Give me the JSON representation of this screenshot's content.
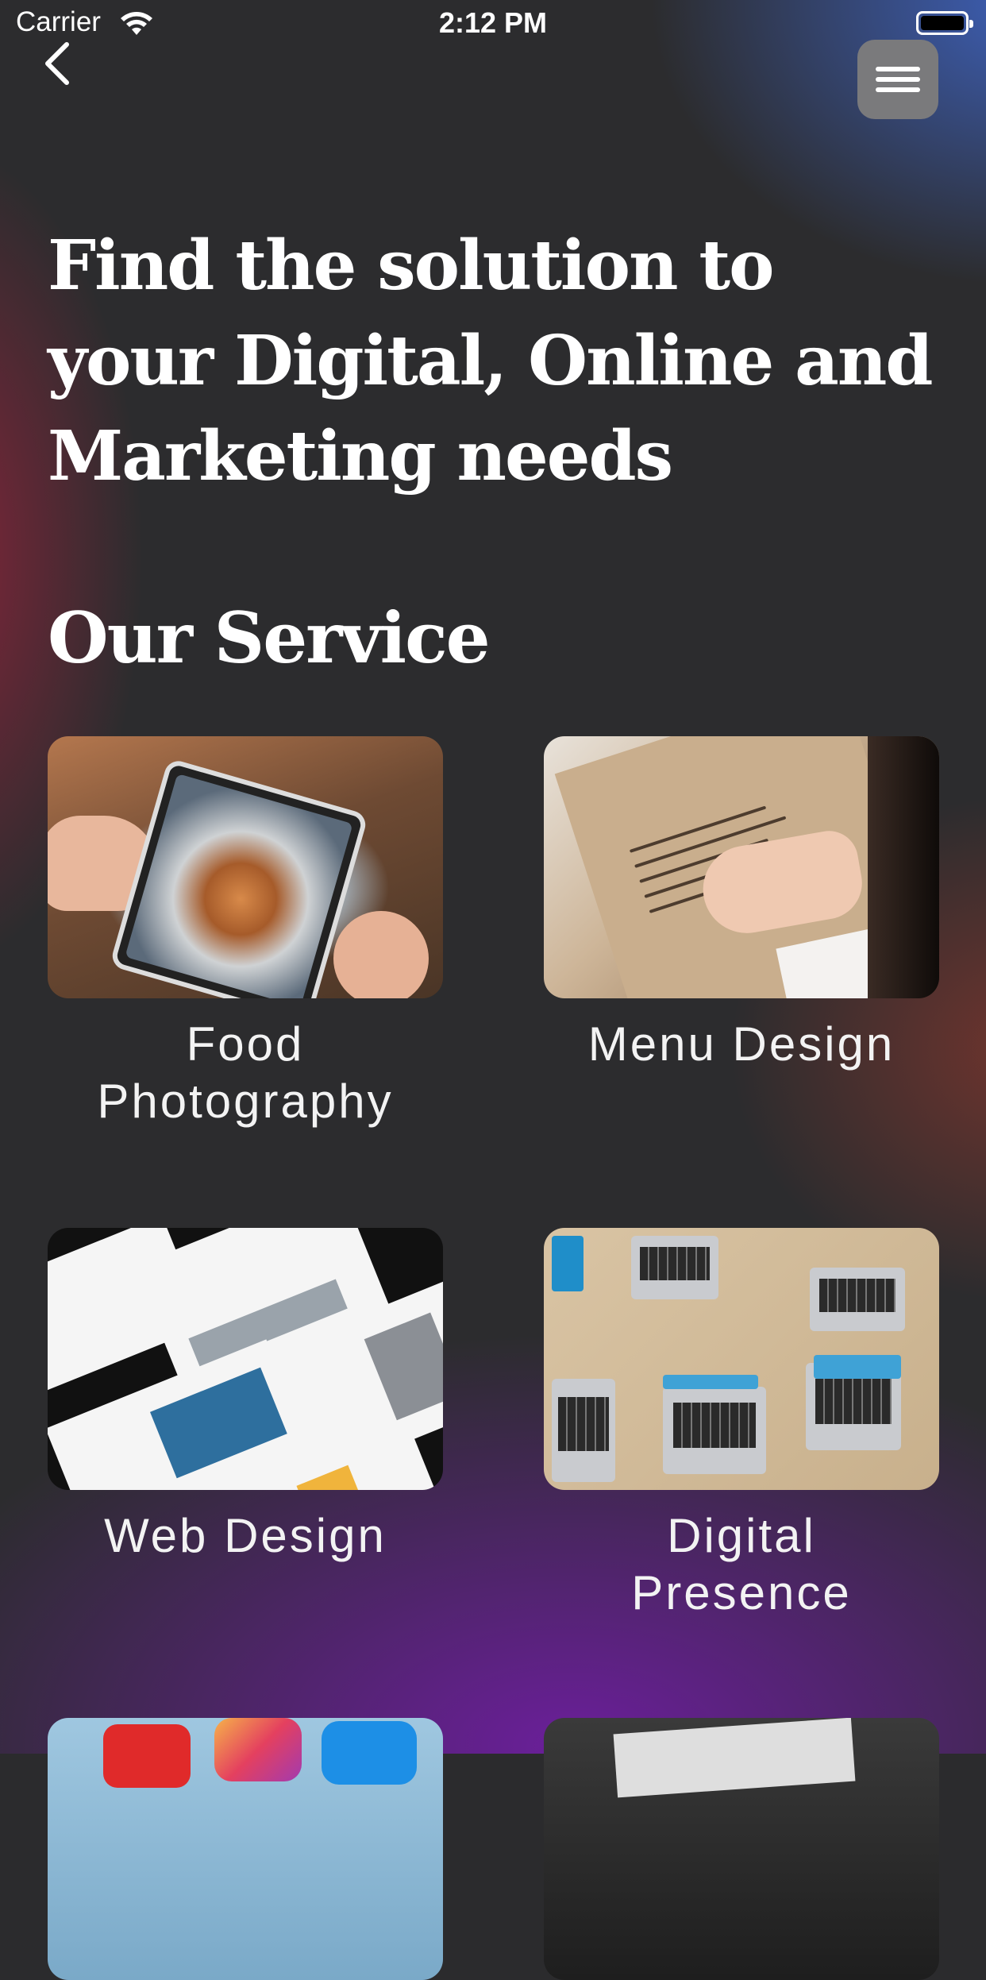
{
  "status_bar": {
    "carrier": "Carrier",
    "time": "2:12 PM"
  },
  "nav": {
    "back_icon": "chevron-left-icon",
    "menu_icon": "hamburger-menu-icon"
  },
  "hero": {
    "title": "Find the solution to your Digital, Online and Marketing needs"
  },
  "services": {
    "heading": "Our Service",
    "items": [
      {
        "label": "Food Photography",
        "image": "food-photography-image"
      },
      {
        "label": "Menu Design",
        "image": "menu-design-image"
      },
      {
        "label": "Web Design",
        "image": "web-design-image"
      },
      {
        "label": "Digital Presence",
        "image": "digital-presence-image"
      },
      {
        "label": "",
        "image": "social-media-image"
      },
      {
        "label": "",
        "image": "marketing-strategy-image"
      }
    ]
  },
  "colors": {
    "background": "#2c2c2e",
    "menu_button": "#7a7a7c",
    "accent_blue": "#3e62be",
    "accent_purple": "#6e1ea0",
    "accent_red": "#96233c"
  }
}
